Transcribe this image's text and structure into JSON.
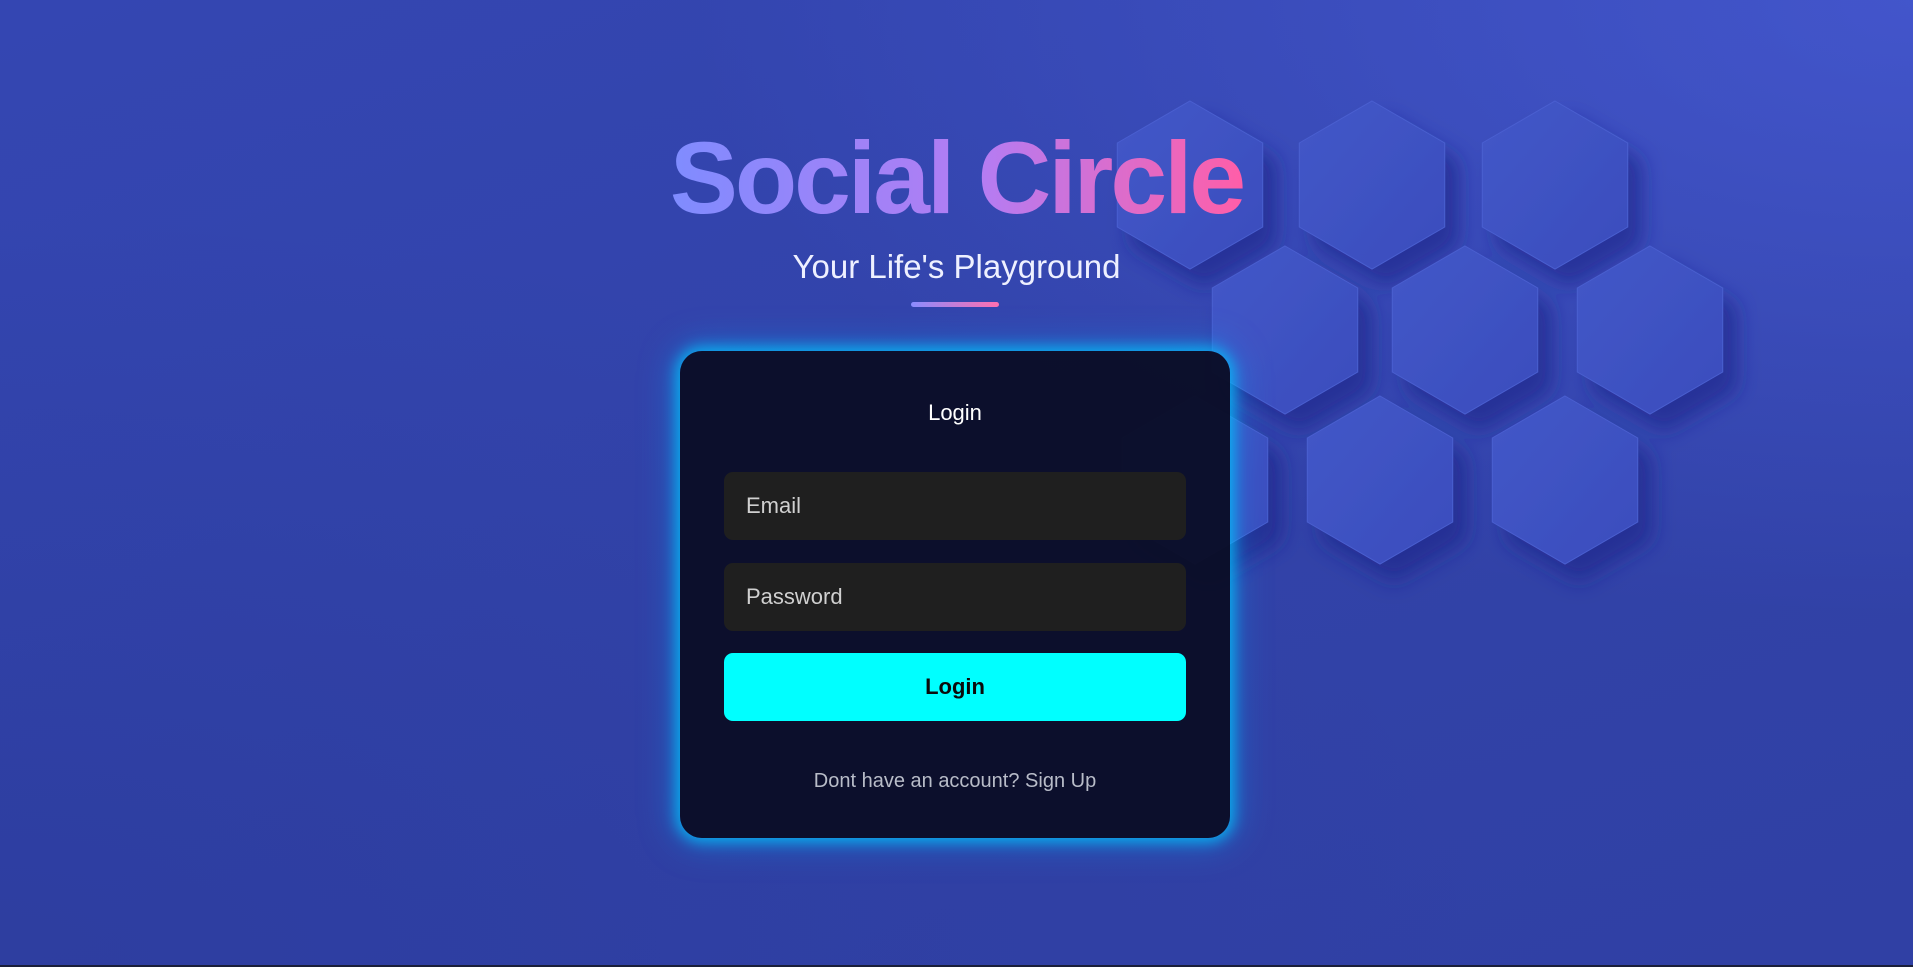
{
  "header": {
    "title": "Social Circle",
    "subtitle": "Your Life's Playground"
  },
  "login_form": {
    "title": "Login",
    "email_placeholder": "Email",
    "password_placeholder": "Password",
    "submit_label": "Login",
    "signup_prompt": "Dont have an account?",
    "signup_link": "Sign Up"
  },
  "colors": {
    "background": "#3144a8",
    "card_background": "#0a0e26",
    "card_glow": "#00c8ff",
    "button": "#00ffff",
    "input_background": "#1f1f1f",
    "title_gradient_start": "#7f8cff",
    "title_gradient_end": "#ff5ea8"
  }
}
